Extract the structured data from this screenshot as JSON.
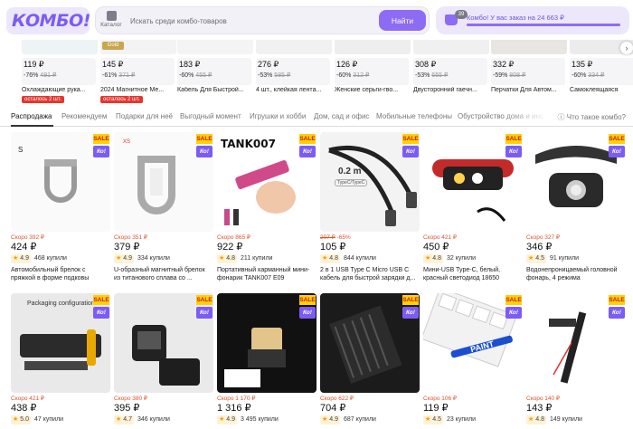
{
  "header": {
    "logo": "КОМБО!",
    "catalog_label": "Каталог",
    "search_placeholder": "Искать среди комбо-товаров",
    "search_button": "Найти",
    "cart_count": "39",
    "cart_text": "Комбо! У вас заказ на 24 663 ₽",
    "cart_progress": 1.0
  },
  "strip": [
    {
      "price": "119 ₽",
      "discount": "-76%",
      "old": "491 ₽",
      "title": "Охлаждающие рука...",
      "badge": "осталось 2 шт."
    },
    {
      "price": "145 ₽",
      "discount": "-61%",
      "old": "371 ₽",
      "title": "2024 Магнитное Ме...",
      "badge": "осталось 2 шт.",
      "tag": "Gold"
    },
    {
      "price": "183 ₽",
      "discount": "-60%",
      "old": "455 ₽",
      "title": "Кабель Для Быстрой..."
    },
    {
      "price": "276 ₽",
      "discount": "-53%",
      "old": "585 ₽",
      "title": "4 шт., клейкая лента..."
    },
    {
      "price": "126 ₽",
      "discount": "-60%",
      "old": "312 ₽",
      "title": "Женские серьги-гво..."
    },
    {
      "price": "308 ₽",
      "discount": "-53%",
      "old": "655 ₽",
      "title": "Двусторонний гаечн..."
    },
    {
      "price": "332 ₽",
      "discount": "-59%",
      "old": "808 ₽",
      "title": "Перчатки Для Автом..."
    },
    {
      "price": "135 ₽",
      "discount": "-60%",
      "old": "334 ₽",
      "title": "Самоклеящаяся"
    }
  ],
  "tabs": [
    "Распродажа",
    "Рекомендуем",
    "Подарки для неё",
    "Выгодный момент",
    "Игрушки и хобби",
    "Дом, сад и офис",
    "Мобильные телефоны",
    "Обустройство дома и инс"
  ],
  "faq": "Что такое комбо?",
  "sale_label": "SALE",
  "ko_label": "Ко!",
  "products": [
    {
      "soon": "Скоро 392 ₽",
      "price": "424 ₽",
      "rating": "4.9",
      "bought": "468 купили",
      "title": "Автомобильный брелок с пряжкой в форме подковы",
      "img": "horseshoe"
    },
    {
      "soon": "Скоро 351 ₽",
      "price": "379 ₽",
      "rating": "4.9",
      "bought": "334 купили",
      "title": "U-образный магнитный брелок из титанового сплава со ...",
      "img": "ushape"
    },
    {
      "soon": "Скоро 865 ₽",
      "price": "922 ₽",
      "rating": "4.8",
      "bought": "211 купили",
      "title": "Портативный карманный мини-фонарик TANK007 E09",
      "img": "tank",
      "brand": "TANK007"
    },
    {
      "soon_old": "207 ₽",
      "soon_disc": "-65%",
      "price": "105 ₽",
      "rating": "4.8",
      "bought": "844 купили",
      "title": "2 в 1 USB Type C Micro USB C кабель для быстрой зарядки д...",
      "img": "cable",
      "cable_len": "0.2 m",
      "cable_type": "TypeC/TypeC"
    },
    {
      "soon": "Скоро 421 ₽",
      "price": "450 ₽",
      "rating": "4.8",
      "bought": "32 купили",
      "title": "Мини-USB Type-C, белый, красный светодиод 18650",
      "img": "headlamp1"
    },
    {
      "soon": "Скоро 327 ₽",
      "price": "346 ₽",
      "rating": "4.5",
      "bought": "91 купили",
      "title": "Водонепроницаемый головной фонарь, 4 режима",
      "img": "headlamp2"
    },
    {
      "soon": "Скоро 421 ₽",
      "price": "438 ₽",
      "rating": "5.0",
      "bought": "47 купили",
      "title": "",
      "img": "packaging",
      "pack_label": "Packaging configuration"
    },
    {
      "soon": "Скоро 380 ₽",
      "price": "395 ₽",
      "rating": "4.7",
      "bought": "346 купили",
      "title": "",
      "img": "bag"
    },
    {
      "soon": "Скоро 1 170 ₽",
      "price": "1 316 ₽",
      "rating": "4.9",
      "bought": "3 495 купили",
      "title": "",
      "img": "switch"
    },
    {
      "soon": "Скоро 622 ₽",
      "price": "704 ₽",
      "rating": "4.9",
      "bought": "687 купили",
      "title": "",
      "img": "heatsink"
    },
    {
      "soon": "Скоро 106 ₽",
      "price": "119 ₽",
      "rating": "4.5",
      "bought": "23 купили",
      "title": "",
      "img": "keyboard",
      "pen_label": "PAINT"
    },
    {
      "soon": "Скоро 140 ₽",
      "price": "143 ₽",
      "rating": "4.8",
      "bought": "149 купили",
      "title": "",
      "img": "wrench"
    }
  ]
}
